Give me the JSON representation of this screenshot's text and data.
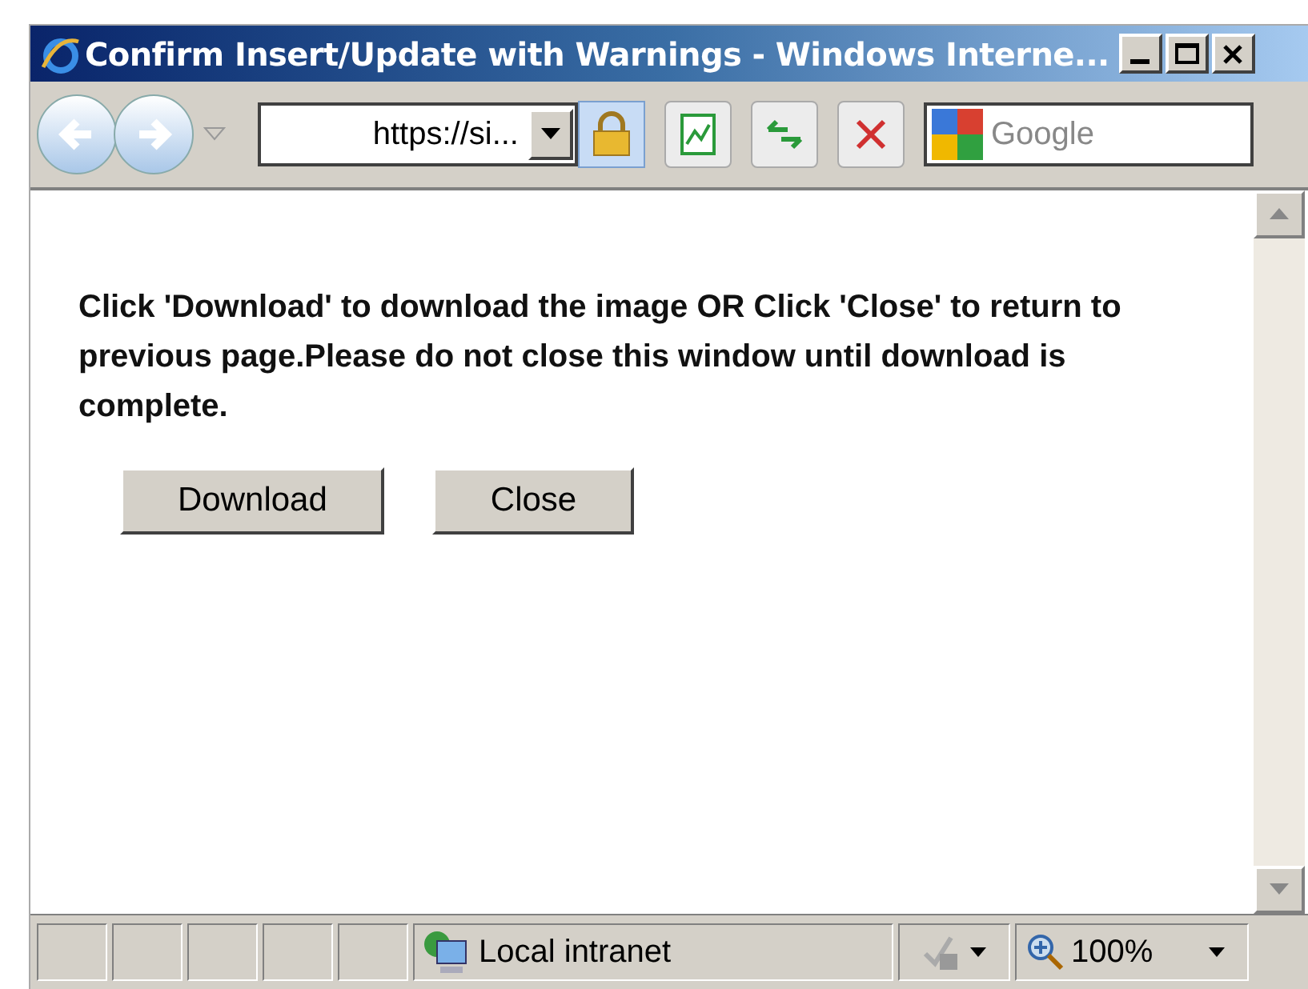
{
  "window": {
    "title": "Confirm Insert/Update with Warnings - Windows Interne..."
  },
  "address_bar": {
    "value": "https://si..."
  },
  "search": {
    "placeholder": "Google"
  },
  "message": "Click 'Download' to download the image OR Click 'Close' to return to previous page.Please do not close this window until download is complete.",
  "buttons": [
    "Download",
    "Close"
  ],
  "status_bar": {
    "zone": "Local intranet",
    "zoom": "100%"
  }
}
